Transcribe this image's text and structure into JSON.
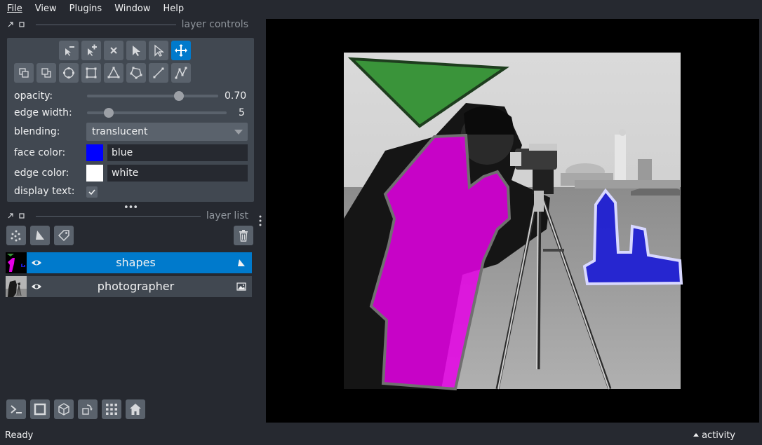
{
  "menu": {
    "items": [
      "File",
      "View",
      "Plugins",
      "Window",
      "Help"
    ]
  },
  "layer_controls": {
    "title": "layer controls",
    "opacity": {
      "label": "opacity:",
      "value": "0.70",
      "fraction": 0.7
    },
    "edge_width": {
      "label": "edge width:",
      "value": "5",
      "fraction": 0.155
    },
    "blending": {
      "label": "blending:",
      "value": "translucent"
    },
    "face_color": {
      "label": "face color:",
      "value": "blue",
      "swatch": "#0000ff"
    },
    "edge_color": {
      "label": "edge color:",
      "value": "white",
      "swatch": "#ffffff"
    },
    "display_text": {
      "label": "display text:",
      "checked": true
    }
  },
  "toolbar": {
    "row1": [
      "remove-vertex-icon",
      "add-vertex-icon",
      "delete-shape-icon",
      "select-icon",
      "direct-select-icon",
      "pan-zoom-icon"
    ],
    "row2": [
      "move-back-icon",
      "move-front-icon",
      "ellipse-icon",
      "rectangle-icon",
      "triangle-icon",
      "polygon-icon",
      "line-icon",
      "path-icon"
    ],
    "active": "pan-zoom-icon"
  },
  "layer_list": {
    "title": "layer list",
    "layers": [
      {
        "name": "shapes",
        "selected": true,
        "visible": true,
        "type": "shapes"
      },
      {
        "name": "photographer",
        "selected": false,
        "visible": true,
        "type": "image"
      }
    ]
  },
  "status": {
    "text": "Ready",
    "activity": "activity"
  },
  "colors": {
    "accent": "#007acc",
    "background": "#262930",
    "panel": "#414851",
    "button": "#5a626c",
    "green_shape": "#3a943a",
    "magenta_shape": "#e600e6",
    "blue_shape": "#1a1ad6"
  }
}
